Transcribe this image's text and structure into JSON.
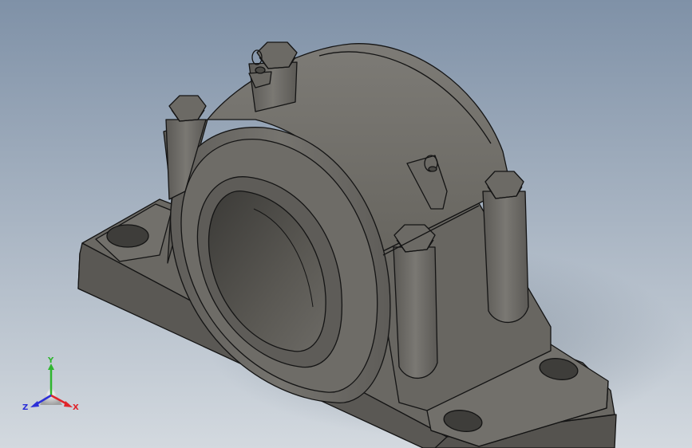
{
  "viewport": {
    "background_top": "#7f91a7",
    "background_bottom": "#d3d9df",
    "model_color": "#6f6d68",
    "edge_color": "#141414"
  },
  "triad": {
    "x_label": "X",
    "y_label": "Y",
    "z_label": "Z",
    "x_color": "#e0242a",
    "y_color": "#2fb52f",
    "z_color": "#2b2fd8"
  }
}
